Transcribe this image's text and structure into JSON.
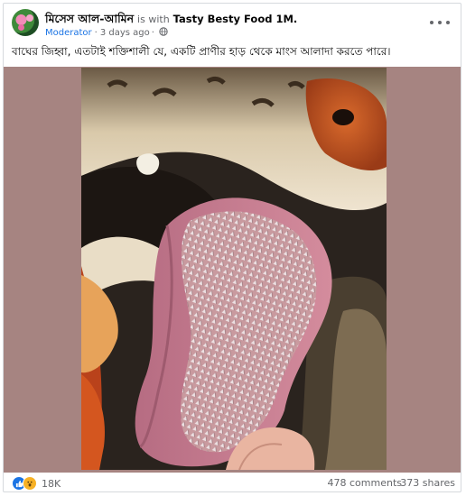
{
  "post": {
    "author": "মিসেস আল-আমিন",
    "is_with": "is with",
    "group": "Tasty Besty Food 1M.",
    "role": "Moderator",
    "time": "3 days ago",
    "separator": "·",
    "caption": "বাঘের জিহ্বা, এতটাই শক্তিশালী যে, একটি প্রাণীর হাড় থেকে মাংস আলাদা করতে পারে।",
    "icons": {
      "more": "more-options-icon",
      "privacy": "globe-icon",
      "reactions": [
        "like-icon",
        "wow-icon"
      ]
    }
  },
  "footer": {
    "reaction_count": "18K",
    "comments": "478 comments",
    "shares": "373 shares"
  },
  "colors": {
    "text": "#050505",
    "secondary": "#65676b",
    "link_blue": "#1b74e4",
    "photo_background": "#a68481"
  }
}
